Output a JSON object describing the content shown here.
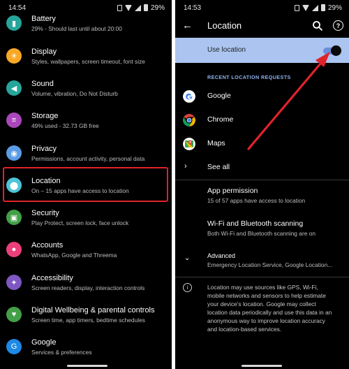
{
  "left": {
    "status": {
      "time": "14:54",
      "battery": "29%"
    },
    "items": [
      {
        "title": "Battery",
        "subtitle": "29% - Should last until about 20:00",
        "icon": "battery-icon",
        "color": "#26a69a",
        "glyph": "▮"
      },
      {
        "title": "Display",
        "subtitle": "Styles, wallpapers, screen timeout, font size",
        "icon": "brightness-icon",
        "color": "#f9a825",
        "glyph": "☀"
      },
      {
        "title": "Sound",
        "subtitle": "Volume, vibration, Do Not Disturb",
        "icon": "volume-icon",
        "color": "#26a69a",
        "glyph": "◀"
      },
      {
        "title": "Storage",
        "subtitle": "49% used - 32.73 GB free",
        "icon": "storage-icon",
        "color": "#ab47bc",
        "glyph": "≡"
      },
      {
        "title": "Privacy",
        "subtitle": "Permissions, account activity, personal data",
        "icon": "eye-icon",
        "color": "#5c9ce6",
        "glyph": "◉"
      },
      {
        "title": "Location",
        "subtitle": "On – 15 apps have access to location",
        "icon": "location-pin-icon",
        "color": "#4fc3d7",
        "glyph": "⬤"
      },
      {
        "title": "Security",
        "subtitle": "Play Protect, screen lock, face unlock",
        "icon": "lock-icon",
        "color": "#43a047",
        "glyph": "▣"
      },
      {
        "title": "Accounts",
        "subtitle": "WhatsApp, Google and Threema",
        "icon": "account-icon",
        "color": "#ec407a",
        "glyph": "●"
      },
      {
        "title": "Accessibility",
        "subtitle": "Screen readers, display, interaction controls",
        "icon": "accessibility-icon",
        "color": "#7e57c2",
        "glyph": "✦"
      },
      {
        "title": "Digital Wellbeing & parental controls",
        "subtitle": "Screen time, app timers, bedtime schedules",
        "icon": "wellbeing-icon",
        "color": "#43a047",
        "glyph": "♥"
      },
      {
        "title": "Google",
        "subtitle": "Services & preferences",
        "icon": "google-g-icon",
        "color": "#1e88e5",
        "glyph": "G"
      }
    ]
  },
  "right": {
    "status": {
      "time": "14:53",
      "battery": "29%"
    },
    "title": "Location",
    "use_location": "Use location",
    "use_location_on": true,
    "recent_header": "RECENT LOCATION REQUESTS",
    "apps": [
      {
        "name": "Google",
        "icon": "google-app-icon"
      },
      {
        "name": "Chrome",
        "icon": "chrome-icon"
      },
      {
        "name": "Maps",
        "icon": "maps-icon"
      }
    ],
    "see_all": "See all",
    "app_permission": {
      "title": "App permission",
      "subtitle": "15 of 57 apps have access to location"
    },
    "scanning": {
      "title": "Wi-Fi and Bluetooth scanning",
      "subtitle": "Both Wi-Fi and Bluetooth scanning are on"
    },
    "advanced": {
      "title": "Advanced",
      "subtitle": "Emergency Location Service, Google Location..."
    },
    "info_lines": [
      "Location may use sources like GPS, Wi-Fi,",
      "mobile networks and sensors to help estimate",
      "your device's location. Google may collect",
      "location data periodically and use this data in an",
      "anonymous way to improve location accuracy",
      "and location-based services."
    ]
  },
  "colors": {
    "highlight": "#e0232b",
    "arrow": "#e0232b",
    "use_location_bg": "#abc5f0",
    "section": "#8fb0ef"
  }
}
